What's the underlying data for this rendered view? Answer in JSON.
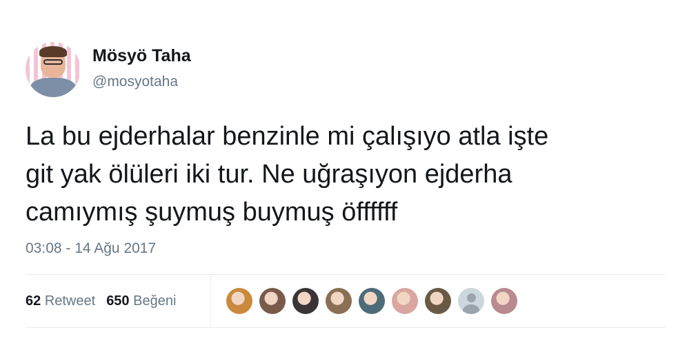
{
  "author": {
    "name": "Mösyö Taha",
    "handle": "@mosyotaha"
  },
  "tweet": {
    "lines": [
      "La bu ejderhalar benzinle mi çalışıyo atla işte",
      "git yak ölüleri iki tur. Ne uğraşıyon ejderha",
      "camıymış şuymuş buymuş öffffff"
    ],
    "timestamp": "03:08 - 14 Ağu 2017"
  },
  "stats": {
    "retweet_count": "62",
    "retweet_label": "Retweet",
    "like_count": "650",
    "like_label": "Beğeni"
  },
  "likers": [
    {
      "icon": "liker-avatar",
      "color": "#c98a3d"
    },
    {
      "icon": "liker-avatar",
      "color": "#7a5a4a"
    },
    {
      "icon": "liker-avatar",
      "color": "#3a3436"
    },
    {
      "icon": "liker-avatar",
      "color": "#8b6f55"
    },
    {
      "icon": "liker-avatar",
      "color": "#4d6b78"
    },
    {
      "icon": "liker-avatar",
      "color": "#d9a6a0"
    },
    {
      "icon": "liker-avatar",
      "color": "#6a5a45"
    },
    {
      "icon": "default-avatar-icon",
      "color": "#ccd6dd"
    },
    {
      "icon": "liker-avatar",
      "color": "#b98a8f"
    }
  ]
}
